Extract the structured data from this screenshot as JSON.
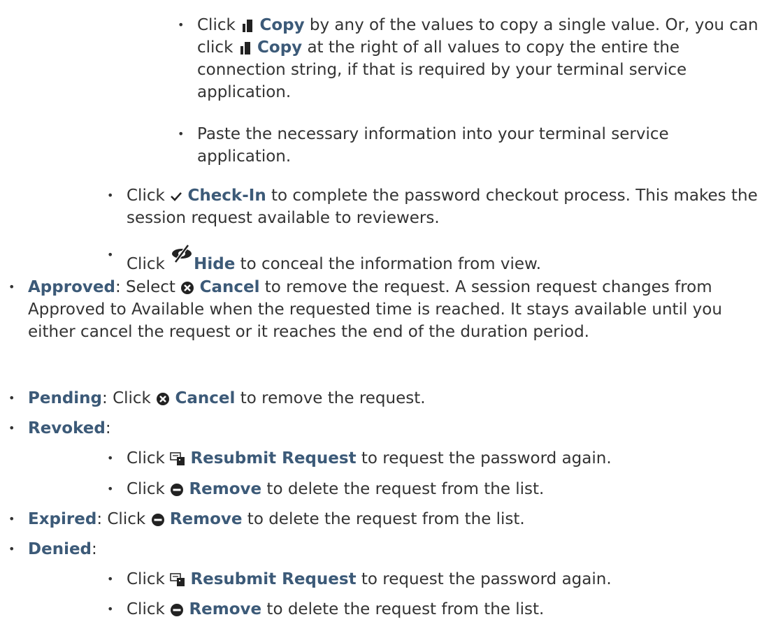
{
  "items": [
    {
      "id": "copy",
      "pre": "Click ",
      "icon": "copy-icon",
      "term": "Copy",
      "post": " by any of the values to copy a single value. Or, you can click ",
      "icon2": "copy-icon",
      "term2": "Copy",
      "post2": " at the right of all values to copy the entire the connection string, if that is required by your terminal service application."
    },
    {
      "id": "paste",
      "pre": "Paste the necessary information into your terminal service application."
    },
    {
      "id": "checkin",
      "pre": "Click ",
      "icon": "checkmark-icon",
      "term": "Check-In",
      "post": " to complete the password checkout process. This makes the session request available to reviewers."
    },
    {
      "id": "hide",
      "pre": "Click ",
      "icon": "eye-slash-icon",
      "term": "Hide",
      "post": " to conceal the information from view."
    },
    {
      "id": "approved",
      "term": "Approved",
      "mid": ": Select ",
      "icon": "cancel-circle-icon",
      "term2": "Cancel",
      "post": " to remove the request. A session request changes from Approved to Available when the requested time is reached. It stays available until you either cancel the request or it reaches the end of the duration period."
    },
    {
      "id": "pending",
      "term": "Pending",
      "mid": ": Click ",
      "icon": "cancel-circle-icon",
      "term2": "Cancel",
      "post": " to remove the request."
    },
    {
      "id": "revoked",
      "term": "Revoked",
      "post": ":"
    },
    {
      "id": "revoked_resubmit",
      "pre": "Click ",
      "icon": "resubmit-icon",
      "term": "Resubmit Request",
      "post": " to request the password again."
    },
    {
      "id": "revoked_remove",
      "pre": "Click ",
      "icon": "remove-circle-icon",
      "term": "Remove",
      "post": " to delete the request from the list."
    },
    {
      "id": "expired",
      "term": "Expired",
      "mid": ": Click ",
      "icon": "remove-circle-icon",
      "term2": "Remove",
      "post": " to delete the request from the list."
    },
    {
      "id": "denied",
      "term": "Denied",
      "post": ":"
    },
    {
      "id": "denied_resubmit",
      "pre": "Click ",
      "icon": "resubmit-icon",
      "term": "Resubmit Request",
      "post": " to request the password again."
    },
    {
      "id": "denied_remove",
      "pre": "Click ",
      "icon": "remove-circle-icon",
      "term": "Remove",
      "post": " to delete the request from the list."
    }
  ],
  "colors": {
    "text": "#333333",
    "term": "#3c5a78",
    "icon": "#222222"
  }
}
